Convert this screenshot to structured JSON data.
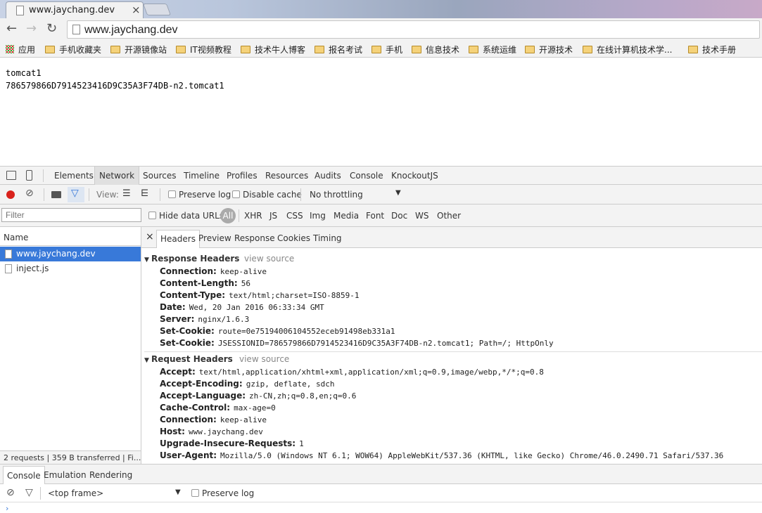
{
  "tab": {
    "title": "www.jaychang.dev",
    "close": "×"
  },
  "omnibox": {
    "url": "www.jaychang.dev"
  },
  "bookmarks": [
    {
      "label": "应用",
      "type": "apps"
    },
    {
      "label": "手机收藏夹",
      "type": "folder"
    },
    {
      "label": "开源镜像站",
      "type": "folder"
    },
    {
      "label": "IT视频教程",
      "type": "folder"
    },
    {
      "label": "技术牛人博客",
      "type": "folder"
    },
    {
      "label": "报名考试",
      "type": "folder"
    },
    {
      "label": "手机",
      "type": "folder"
    },
    {
      "label": "信息技术",
      "type": "folder"
    },
    {
      "label": "系统运维",
      "type": "folder"
    },
    {
      "label": "开源技术",
      "type": "folder"
    },
    {
      "label": "在线计算机技术学...",
      "type": "folder"
    },
    {
      "label": "技术手册",
      "type": "folder"
    }
  ],
  "page": {
    "line1": "tomcat1",
    "line2": "786579866D7914523416D9C35A3F74DB-n2.tomcat1"
  },
  "devtools": {
    "tabs": [
      "Elements",
      "Network",
      "Sources",
      "Timeline",
      "Profiles",
      "Resources",
      "Audits",
      "Console",
      "KnockoutJS"
    ],
    "toolbar": {
      "view_label": "View:",
      "preserve_log": "Preserve log",
      "disable_cache": "Disable cache",
      "throttle": "No throttling"
    },
    "filter": {
      "placeholder": "Filter",
      "hide_data_urls": "Hide data URLs",
      "all": "All",
      "types": [
        "XHR",
        "JS",
        "CSS",
        "Img",
        "Media",
        "Font",
        "Doc",
        "WS",
        "Other"
      ]
    },
    "requests": {
      "header": "Name",
      "items": [
        "www.jaychang.dev",
        "inject.js"
      ],
      "status": "2 requests  |  359 B transferred  |  Fi..."
    },
    "detail_tabs": [
      "Headers",
      "Preview",
      "Response",
      "Cookies",
      "Timing"
    ],
    "close": "×",
    "response_headers": {
      "title": "Response Headers",
      "view_source": "view source",
      "rows": [
        {
          "k": "Connection:",
          "v": "keep-alive"
        },
        {
          "k": "Content-Length:",
          "v": "56"
        },
        {
          "k": "Content-Type:",
          "v": "text/html;charset=ISO-8859-1"
        },
        {
          "k": "Date:",
          "v": "Wed, 20 Jan 2016 06:33:34 GMT"
        },
        {
          "k": "Server:",
          "v": "nginx/1.6.3"
        },
        {
          "k": "Set-Cookie:",
          "v": "route=0e75194006104552eceb91498eb331a1"
        },
        {
          "k": "Set-Cookie:",
          "v": "JSESSIONID=786579866D7914523416D9C35A3F74DB-n2.tomcat1; Path=/; HttpOnly"
        }
      ]
    },
    "request_headers": {
      "title": "Request Headers",
      "view_source": "view source",
      "rows": [
        {
          "k": "Accept:",
          "v": "text/html,application/xhtml+xml,application/xml;q=0.9,image/webp,*/*;q=0.8"
        },
        {
          "k": "Accept-Encoding:",
          "v": "gzip, deflate, sdch"
        },
        {
          "k": "Accept-Language:",
          "v": "zh-CN,zh;q=0.8,en;q=0.6"
        },
        {
          "k": "Cache-Control:",
          "v": "max-age=0"
        },
        {
          "k": "Connection:",
          "v": "keep-alive"
        },
        {
          "k": "Host:",
          "v": "www.jaychang.dev"
        },
        {
          "k": "Upgrade-Insecure-Requests:",
          "v": "1"
        },
        {
          "k": "User-Agent:",
          "v": "Mozilla/5.0 (Windows NT 6.1; WOW64) AppleWebKit/537.36 (KHTML, like Gecko) Chrome/46.0.2490.71 Safari/537.36"
        }
      ]
    },
    "drawer": {
      "tabs": [
        "Console",
        "Emulation",
        "Rendering"
      ],
      "frame": "<top frame>",
      "preserve_log": "Preserve log"
    }
  }
}
